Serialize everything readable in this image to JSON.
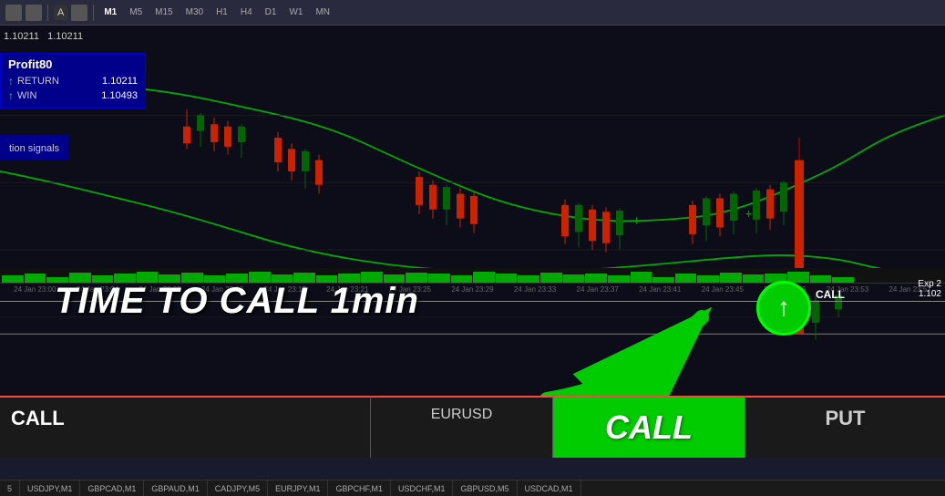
{
  "toolbar": {
    "icons": [
      "cursor",
      "crosshair",
      "text",
      "marker",
      "arrow"
    ],
    "timeframes": [
      "M1",
      "M5",
      "M15",
      "M30",
      "H1",
      "H4",
      "D1",
      "W1",
      "MN"
    ],
    "active_timeframe": "M1"
  },
  "chart": {
    "price_high": "1.10211",
    "price_low": "1.10211",
    "symbol": "EURUSD",
    "info_box": {
      "title": "Profit80",
      "return_label": "RETURN",
      "return_value": "1.10211",
      "win_label": "WIN",
      "win_value": "1.10493"
    },
    "signals_label": "tion signals",
    "exp_label": "Exp 2",
    "exp_price": "1.102"
  },
  "signal": {
    "time_to_call_text": "TIME TO CALL 1min",
    "call_circle_arrow": "↑",
    "call_chart_label": "CALL"
  },
  "bottom_bar": {
    "call_label": "CALL",
    "eurusd_label": "EURUSD",
    "green_call_label": "CALL",
    "put_label": "PUT"
  },
  "timestamps": [
    "24 Jan 23:00",
    "24 Jan 23:04",
    "24 Jan 23:08",
    "24 Jan 23:12",
    "24 Jan 23:17",
    "24 Jan 23:21",
    "24 Jan 23:25",
    "24 Jan 23:29",
    "24 Jan 23:33",
    "24 Jan 23:37",
    "24 Jan 23:41",
    "24 Jan 23:45",
    "24 Jan 23:49",
    "24 Jan 23:53",
    "24 Jan 23:57"
  ],
  "symbol_tabs": [
    "5",
    "USDJPY,M1",
    "GBPCAD,M1",
    "GBPAUD,M1",
    "CADJPY,M5",
    "EURJPY,M1",
    "GBPCHF,M1",
    "USDCHF,M1",
    "GBPUSD,M5",
    "USDCAD,M1"
  ]
}
